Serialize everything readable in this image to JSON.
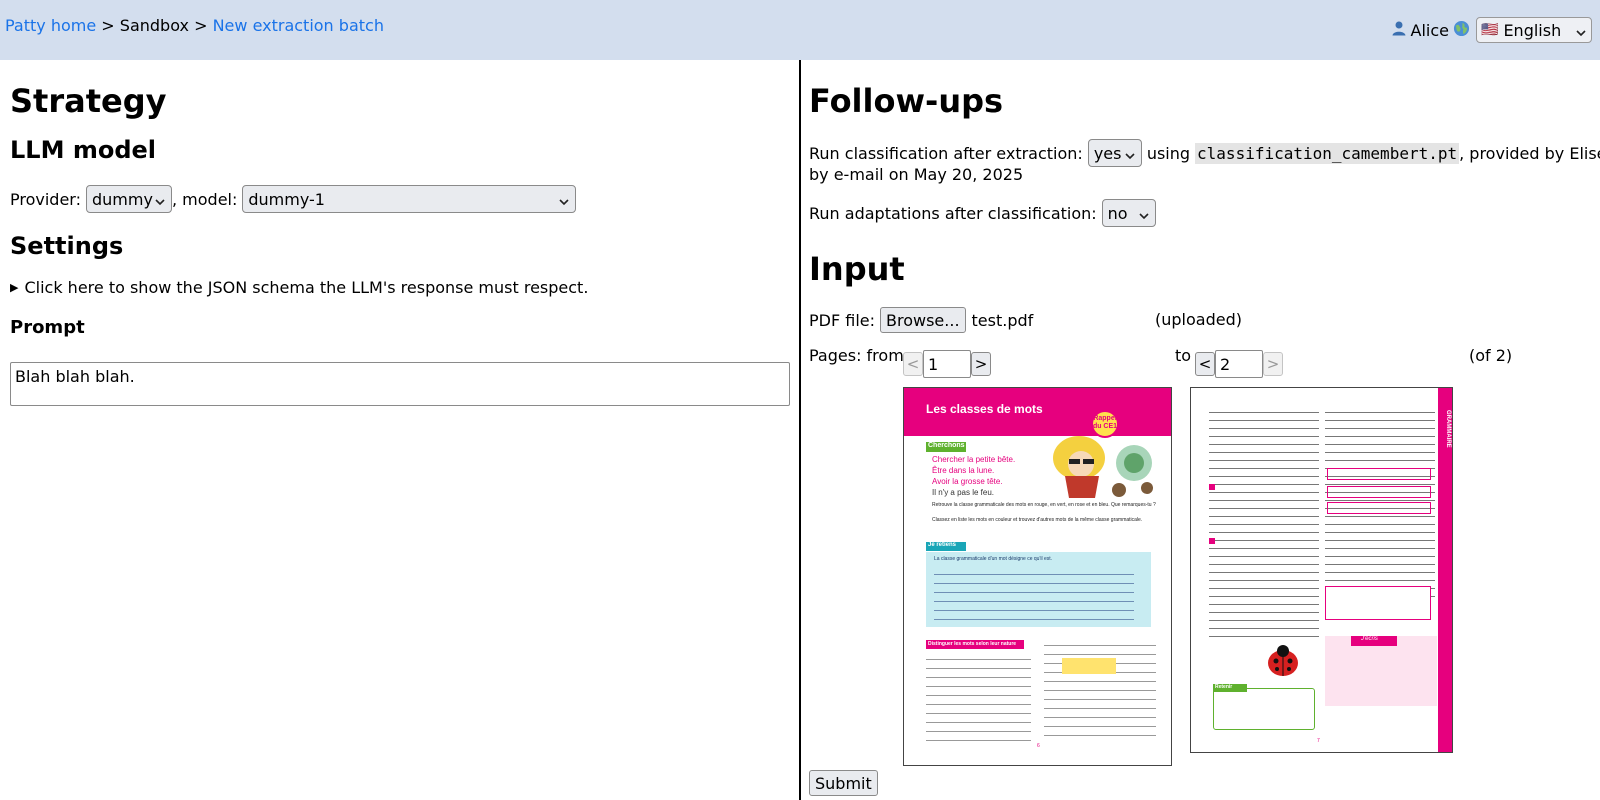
{
  "breadcrumb": {
    "home": "Patty home",
    "sep1": ">",
    "sandbox": "Sandbox",
    "sep2": ">",
    "current": "New extraction batch"
  },
  "user": {
    "icon": "user-icon",
    "name": "Alice",
    "globe_icon": "globe-icon",
    "language_flag": "🇺🇸",
    "language": "English"
  },
  "strategy": {
    "title": "Strategy",
    "llm_heading": "LLM model",
    "provider_label": "Provider:",
    "provider_value": "dummy",
    "model_label": ", model:",
    "model_value": "dummy-1",
    "settings_heading": "Settings",
    "schema_toggle": "Click here to show the JSON schema the LLM's response must respect.",
    "prompt_heading": "Prompt",
    "prompt_value": "Blah blah blah."
  },
  "followups": {
    "title": "Follow-ups",
    "classification_label": "Run classification after extraction:",
    "classification_value": "yes",
    "using": "using",
    "model_file": "classification_camembert.pt",
    "provided_by": ", provided by Elise",
    "provided_by_line2": "by e-mail on May 20, 2025",
    "adaptations_label": "Run adaptations after classification:",
    "adaptations_value": "no"
  },
  "input": {
    "title": "Input",
    "pdf_label": "PDF file:",
    "browse_label": "Browse...",
    "file_name": "test.pdf",
    "upload_status": "(uploaded)",
    "pages_from_label": "Pages: from",
    "from_value": "1",
    "to_label": "to",
    "to_value": "2",
    "of_total": "(of 2)",
    "prev_symbol": "<",
    "next_symbol": ">",
    "submit_label": "Submit"
  },
  "thumb1": {
    "banner": "Les classes de mots",
    "sticker": "Rappel du CE1",
    "cherchons": "Cherchons",
    "line1": "Chercher la petite bête.",
    "line2": "Être dans la lune.",
    "line3": "Avoir la grosse tête.",
    "line4": "Il n'y a pas le feu.",
    "instr1": "Retrouve la classe grammaticale des mots en rouge, en vert, en rose et en bleu. Que remarques-tu ?",
    "instr2": "Classez en liste les mots en couleur et trouvez d'autres mots de la même classe grammaticale.",
    "je_retiens": "Je retiens",
    "retiens_text": "La classe grammaticale d'un mot désigne ce qu'il est.",
    "exercise_band": "Distinguer les mots selon leur nature",
    "page_number": "6"
  },
  "thumb2": {
    "side_label": "GRAMMAIRE",
    "ecris": "J'écris",
    "retenir": "Retenir",
    "page_number": "7"
  },
  "colors": {
    "topbar": "#d3deee",
    "link": "#1a73e8",
    "magenta": "#e6007e",
    "green": "#5fb12e",
    "teal": "#1aa6b7",
    "light_teal": "#c8ecf2"
  }
}
